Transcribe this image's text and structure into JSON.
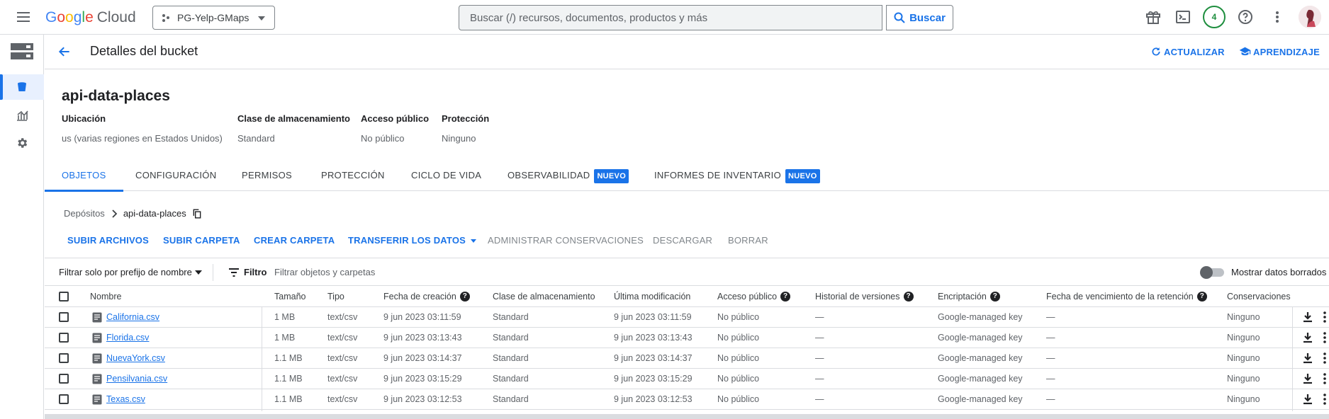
{
  "topbar": {
    "logo_parts": [
      "G",
      "o",
      "o",
      "g",
      "l",
      "e"
    ],
    "logo_cloud": "Cloud",
    "project_name": "PG-Yelp-GMaps",
    "search_placeholder": "Buscar (/) recursos, documentos, productos y más",
    "search_button": "Buscar",
    "notifications_count": "4"
  },
  "page": {
    "title": "Detalles del bucket",
    "refresh": "ACTUALIZAR",
    "learn": "APRENDIZAJE"
  },
  "bucket": {
    "name": "api-data-places",
    "meta": [
      {
        "key": "Ubicación",
        "value": "us (varias regiones en Estados Unidos)"
      },
      {
        "key": "Clase de almacenamiento",
        "value": "Standard"
      },
      {
        "key": "Acceso público",
        "value": "No público"
      },
      {
        "key": "Protección",
        "value": "Ninguno"
      }
    ]
  },
  "tabs": [
    {
      "label": "OBJETOS",
      "active": true
    },
    {
      "label": "CONFIGURACIÓN"
    },
    {
      "label": "PERMISOS"
    },
    {
      "label": "PROTECCIÓN"
    },
    {
      "label": "CICLO DE VIDA"
    },
    {
      "label": "OBSERVABILIDAD",
      "badge": "NUEVO"
    },
    {
      "label": "INFORMES DE INVENTARIO",
      "badge": "NUEVO"
    }
  ],
  "breadcrumb": {
    "root": "Depósitos",
    "current": "api-data-places"
  },
  "actions": [
    {
      "label": "SUBIR ARCHIVOS",
      "enabled": true
    },
    {
      "label": "SUBIR CARPETA",
      "enabled": true
    },
    {
      "label": "CREAR CARPETA",
      "enabled": true
    },
    {
      "label": "TRANSFERIR LOS DATOS",
      "enabled": true
    },
    {
      "label": "ADMINISTRAR CONSERVACIONES",
      "enabled": false
    },
    {
      "label": "DESCARGAR",
      "enabled": false
    },
    {
      "label": "BORRAR",
      "enabled": false
    }
  ],
  "filter": {
    "prefix_label": "Filtrar solo por prefijo de nombre",
    "filter_label": "Filtro",
    "placeholder": "Filtrar objetos y carpetas",
    "show_deleted": "Mostrar datos borrados"
  },
  "table": {
    "columns": [
      "Nombre",
      "Tamaño",
      "Tipo",
      "Fecha de creación",
      "Clase de almacenamiento",
      "Última modificación",
      "Acceso público",
      "Historial de versiones",
      "Encriptación",
      "Fecha de vencimiento de la retención",
      "Conservaciones"
    ],
    "rows": [
      [
        "California.csv",
        "1 MB",
        "text/csv",
        "9 jun 2023 03:11:59",
        "Standard",
        "9 jun 2023 03:11:59",
        "No público",
        "—",
        "Google-managed key",
        "—",
        "Ninguno"
      ],
      [
        "Florida.csv",
        "1 MB",
        "text/csv",
        "9 jun 2023 03:13:43",
        "Standard",
        "9 jun 2023 03:13:43",
        "No público",
        "—",
        "Google-managed key",
        "—",
        "Ninguno"
      ],
      [
        "NuevaYork.csv",
        "1.1 MB",
        "text/csv",
        "9 jun 2023 03:14:37",
        "Standard",
        "9 jun 2023 03:14:37",
        "No público",
        "—",
        "Google-managed key",
        "—",
        "Ninguno"
      ],
      [
        "Pensilvania.csv",
        "1.1 MB",
        "text/csv",
        "9 jun 2023 03:15:29",
        "Standard",
        "9 jun 2023 03:15:29",
        "No público",
        "—",
        "Google-managed key",
        "—",
        "Ninguno"
      ],
      [
        "Texas.csv",
        "1.1 MB",
        "text/csv",
        "9 jun 2023 03:12:53",
        "Standard",
        "9 jun 2023 03:12:53",
        "No público",
        "—",
        "Google-managed key",
        "—",
        "Ninguno"
      ]
    ]
  },
  "colors": {
    "accent": "#1a73e8",
    "border": "#dadce0",
    "green": "#1e8e3e"
  }
}
